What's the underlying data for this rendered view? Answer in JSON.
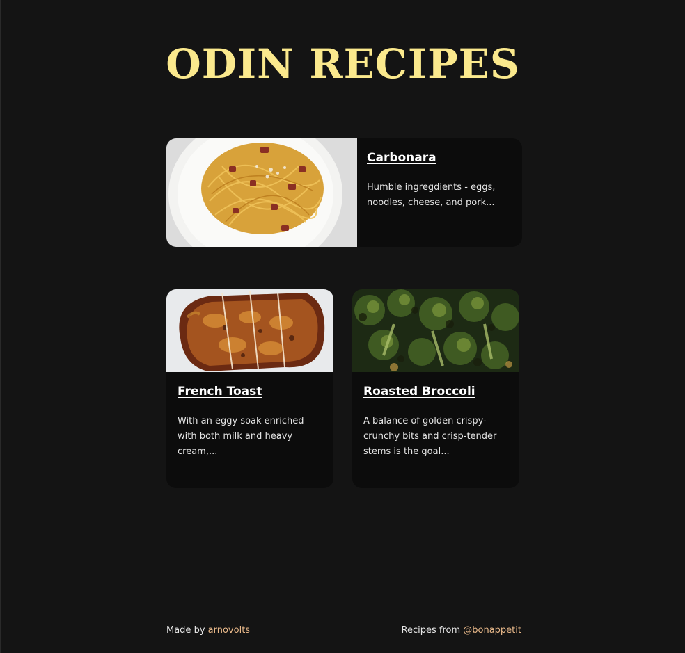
{
  "site": {
    "title": "ODIN RECIPES"
  },
  "recipes": [
    {
      "title": "Carbonara",
      "description": "Humble ingregdients - eggs, noodles, cheese, and pork...",
      "image_icon": "carbonara-photo"
    },
    {
      "title": "French Toast",
      "description": "With an eggy soak enriched with both milk and heavy cream,...",
      "image_icon": "french-toast-photo"
    },
    {
      "title": "Roasted Broccoli",
      "description": "A balance of golden crispy-crunchy bits and crisp-tender stems is the goal...",
      "image_icon": "roasted-broccoli-photo"
    }
  ],
  "footer": {
    "made_by_prefix": "Made by",
    "made_by_link": "arnovolts",
    "recipes_from_prefix": "Recipes from",
    "recipes_from_link": "@bonappetit"
  },
  "colors": {
    "background": "#141414",
    "card": "#0c0c0c",
    "title": "#fbe98d",
    "link": "#e9b98a"
  }
}
